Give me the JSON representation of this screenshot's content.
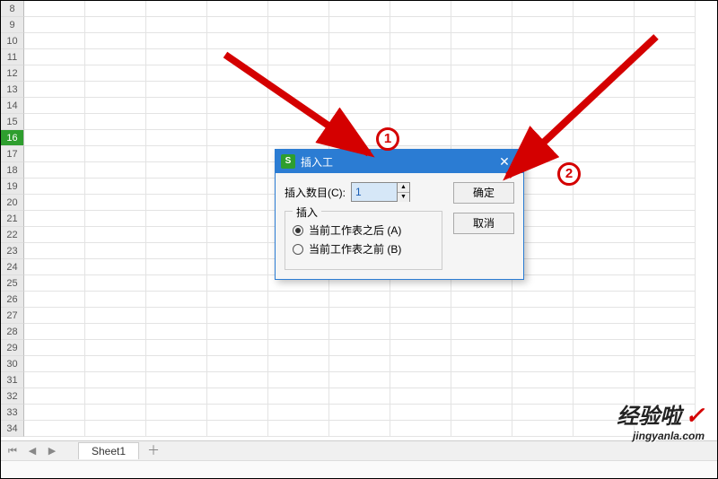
{
  "rows": [
    "8",
    "9",
    "10",
    "11",
    "12",
    "13",
    "14",
    "15",
    "16",
    "17",
    "18",
    "19",
    "20",
    "21",
    "22",
    "23",
    "24",
    "25",
    "26",
    "27",
    "28",
    "29",
    "30",
    "31",
    "32",
    "33",
    "34"
  ],
  "selected_row": "16",
  "tabbar": {
    "sheet": "Sheet1"
  },
  "statusbar": {
    "text": ""
  },
  "dialog": {
    "icon": "S",
    "title": "插入工",
    "count_label": "插入数目(C):",
    "count_value": "1",
    "legend": "插入",
    "option_after": "当前工作表之后 (A)",
    "option_before": "当前工作表之前 (B)",
    "ok": "确定",
    "cancel": "取消"
  },
  "markers": {
    "one": "1",
    "two": "2"
  },
  "watermark": {
    "big": "经验啦",
    "check": "✓",
    "small": "jingyanla.com"
  }
}
